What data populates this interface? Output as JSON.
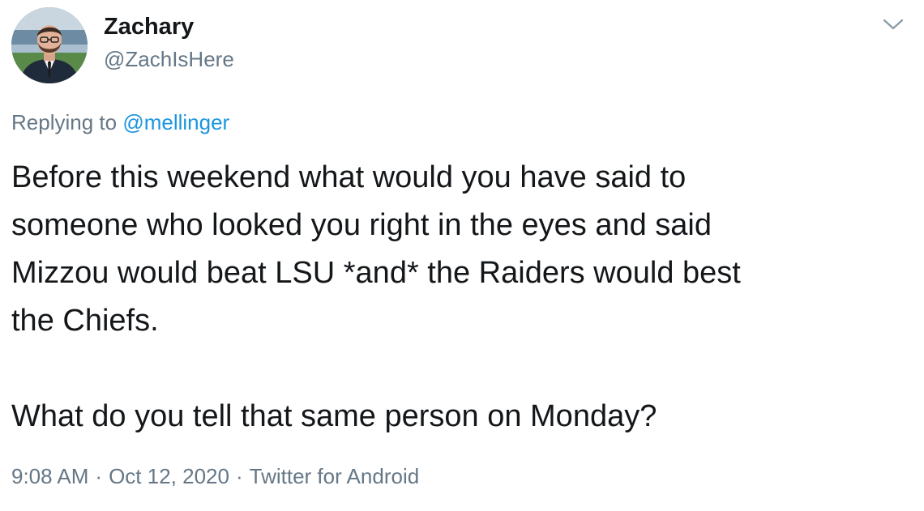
{
  "author": {
    "display_name": "Zachary",
    "handle": "@ZachIsHere"
  },
  "replying": {
    "prefix": "Replying to ",
    "mention": "@mellinger"
  },
  "tweet": {
    "lines": [
      "Before this weekend what would you have said to",
      "someone who looked you right in the eyes and said",
      "Mizzou would beat LSU *and* the Raiders would best",
      "the Chiefs."
    ],
    "second_paragraph": "What do you tell that same person on Monday?"
  },
  "meta": {
    "time": "9:08 AM",
    "date": "Oct 12, 2020",
    "source": "Twitter for Android",
    "separator": "·"
  },
  "icons": {
    "menu": "chevron-down-icon",
    "avatar": "profile-photo"
  },
  "colors": {
    "text": "#14171a",
    "secondary": "#657786",
    "link": "#1b95e0"
  }
}
